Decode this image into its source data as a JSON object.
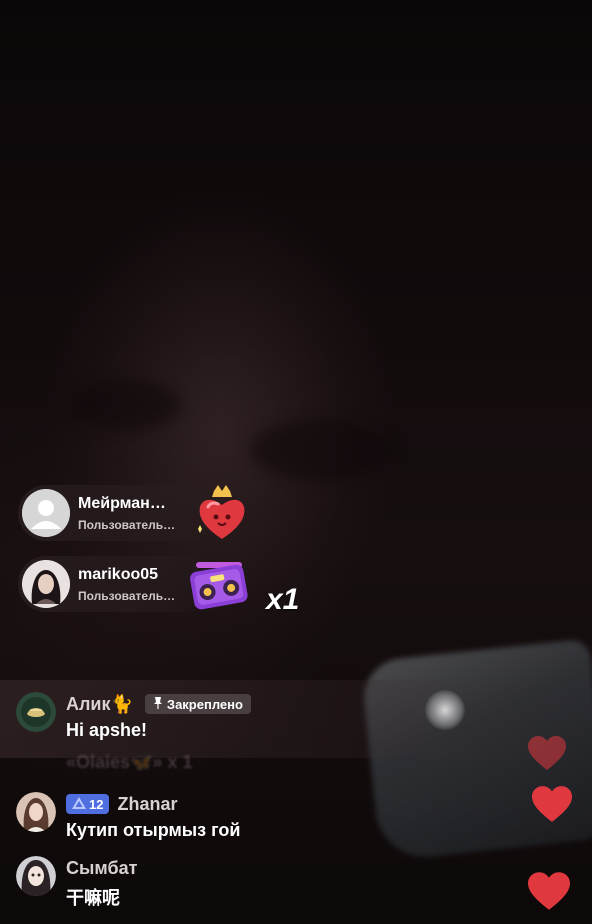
{
  "gift_notifications": [
    {
      "username": "Мейрман…",
      "subtitle": "Пользователь…",
      "gift_icon": "heart-crown-gift-icon",
      "avatar": "default-avatar-icon"
    },
    {
      "username": "marikoo05",
      "subtitle": "Пользователь…",
      "gift_icon": "boombox-gift-icon",
      "avatar": "user-photo-avatar",
      "count": "x1"
    }
  ],
  "comments": [
    {
      "username": "Алик🐈",
      "text": "Hi apshe!",
      "pinned_label": "Закреплено",
      "pinned": true
    },
    {
      "username": "Zhanar",
      "level": "12",
      "text": "Кутип отырмыз гой"
    },
    {
      "username": "Сымбат",
      "text": "干嘛呢"
    }
  ],
  "faded_comment_fragment": "«Olaies🦋» x 1",
  "colors": {
    "heart": "#e0383f",
    "level_badge": "#4f6ee0"
  }
}
